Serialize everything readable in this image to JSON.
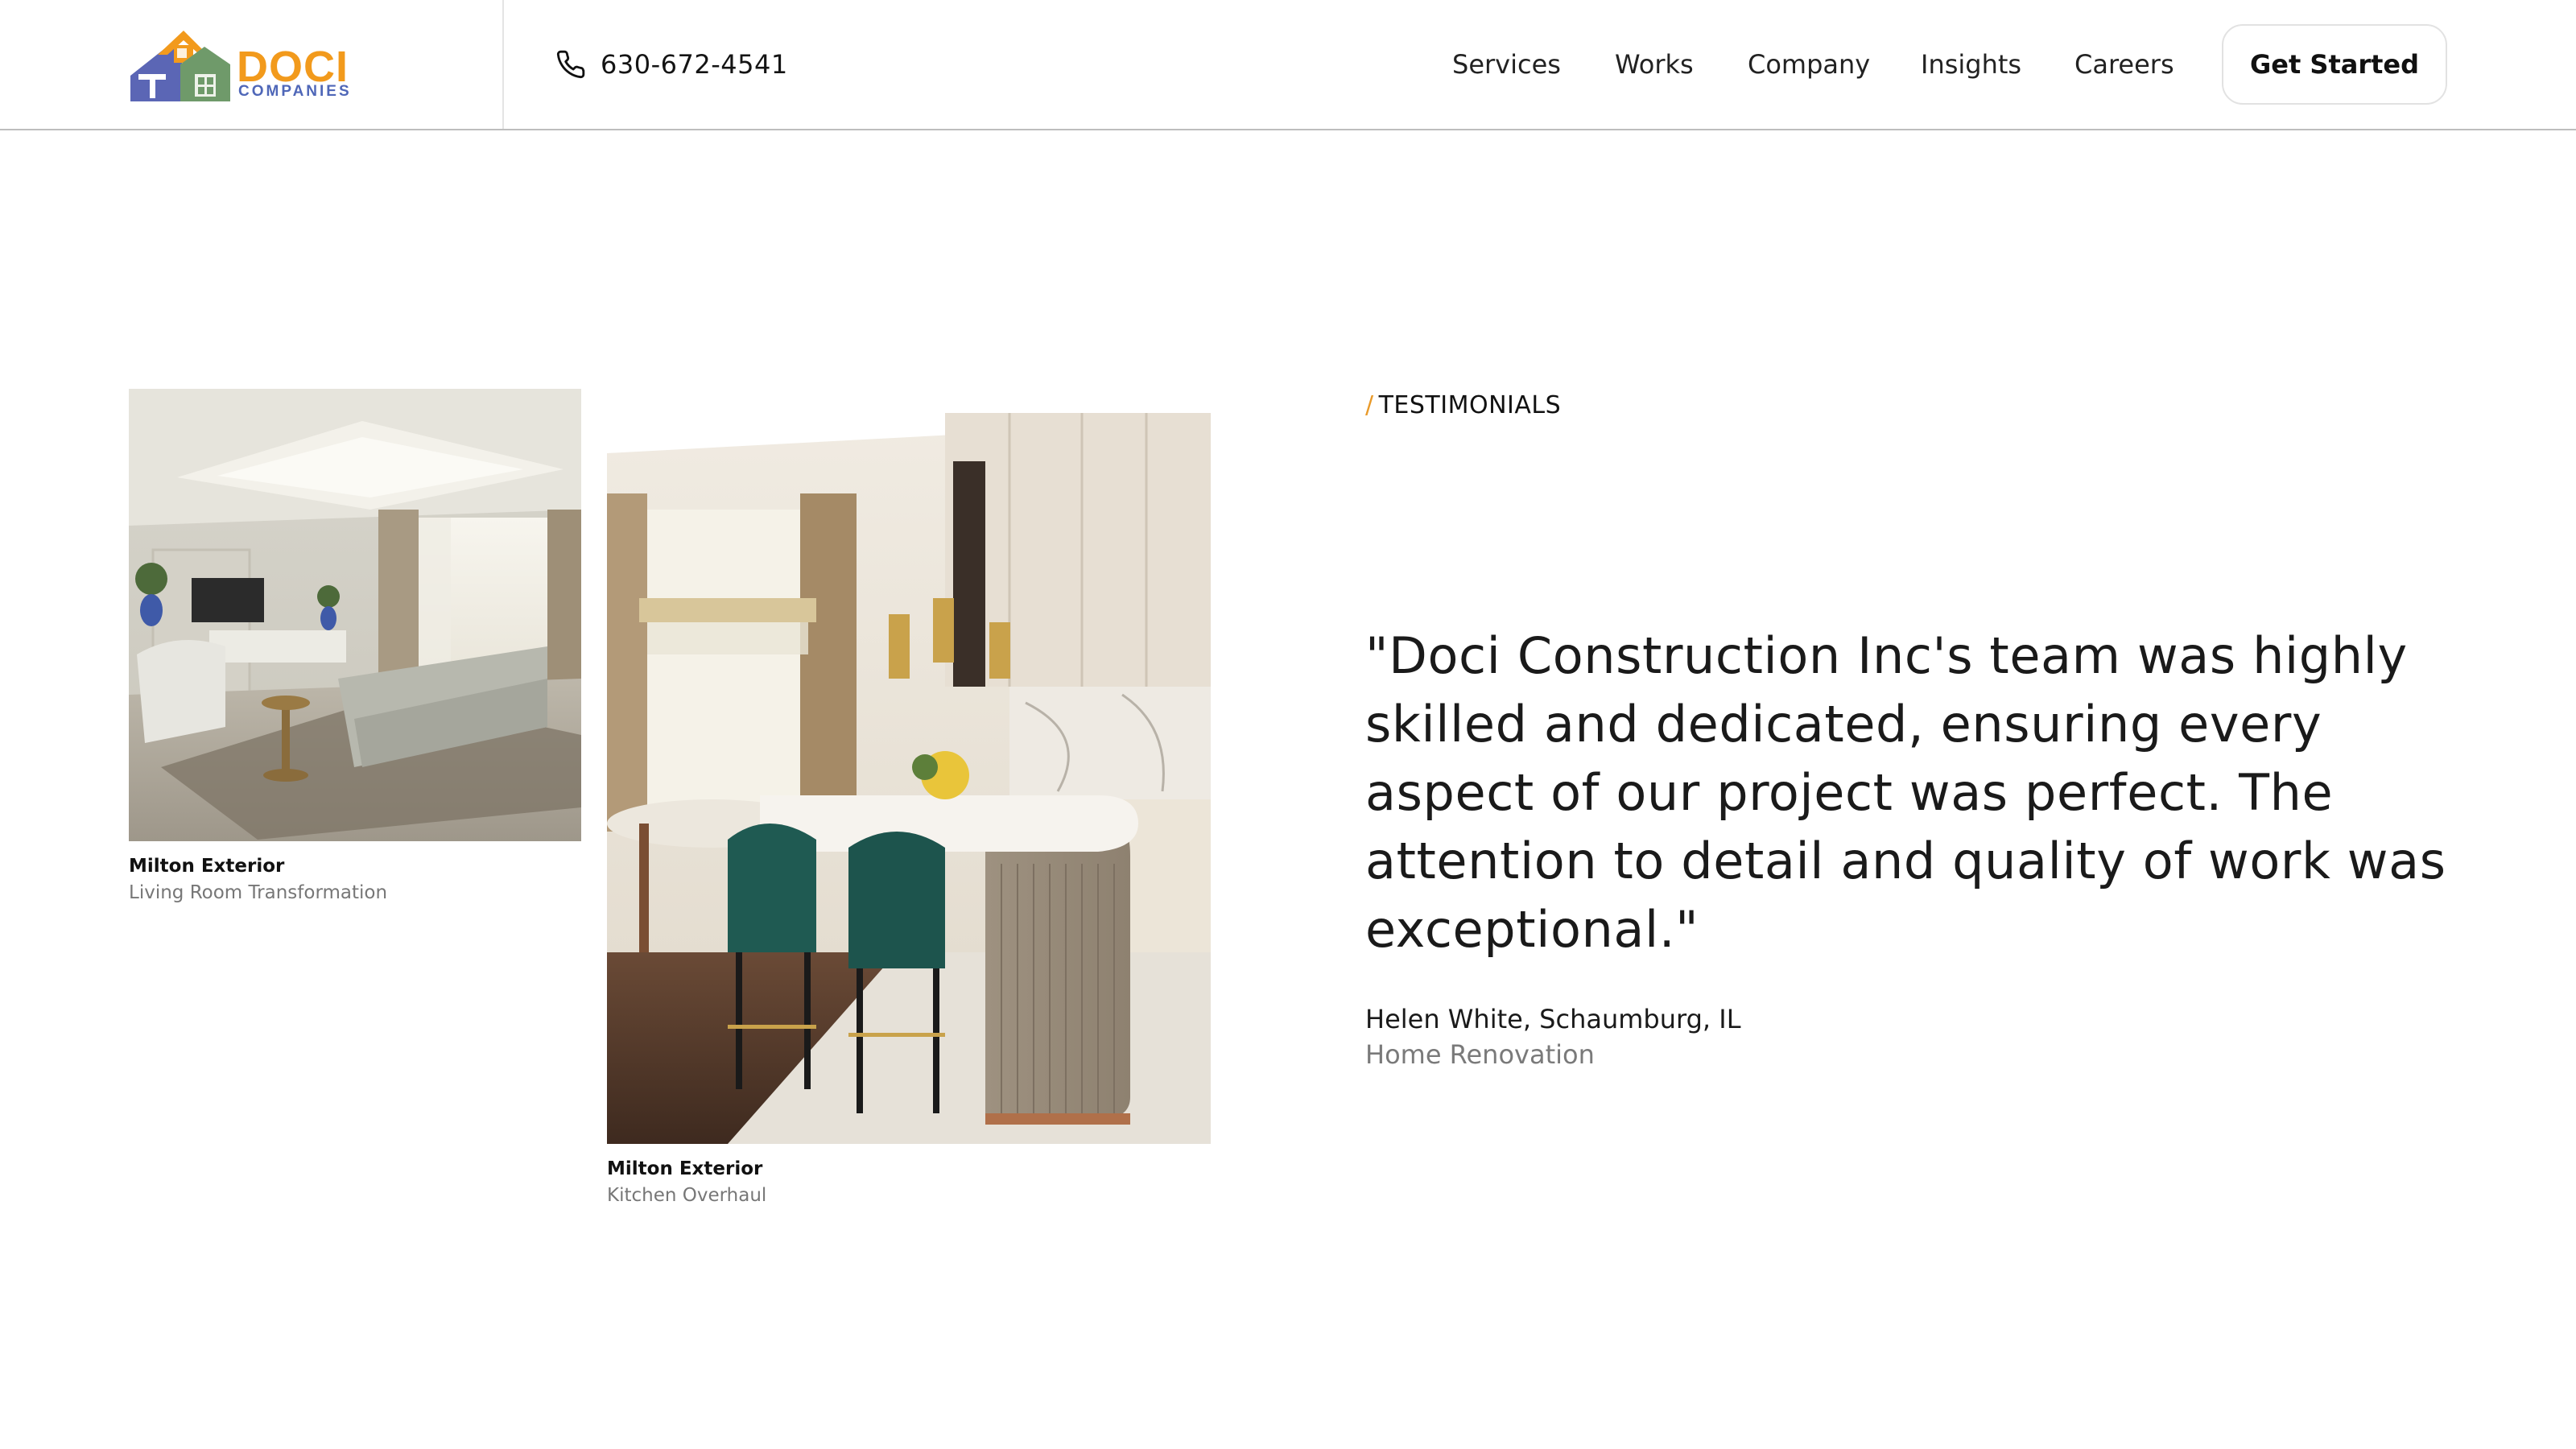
{
  "brand": {
    "name": "DOCI",
    "tagline": "COMPANIES",
    "colors": {
      "orange": "#f29a1c",
      "blue": "#4f67b8",
      "green": "#6f9a6a"
    }
  },
  "header": {
    "phone": "630-672-4541",
    "nav": [
      {
        "label": "Services"
      },
      {
        "label": "Works"
      },
      {
        "label": "Company"
      },
      {
        "label": "Insights"
      },
      {
        "label": "Careers"
      }
    ],
    "cta_label": "Get Started"
  },
  "projects": [
    {
      "title": "Milton Exterior",
      "subtitle": "Living Room Transformation"
    },
    {
      "title": "Milton Exterior",
      "subtitle": "Kitchen Overhaul"
    }
  ],
  "testimonial": {
    "eyebrow_mark": "/",
    "eyebrow": "TESTIMONIALS",
    "quote": "\"Doci Construction Inc's team was highly skilled and dedicated, ensuring every aspect of our project was perfect. The attention to detail and quality of work was exceptional.\"",
    "author": "Helen White, Schaumburg, IL",
    "project": "Home Renovation"
  },
  "icons": {
    "phone": "phone-icon",
    "logo": "house-logo-icon"
  }
}
